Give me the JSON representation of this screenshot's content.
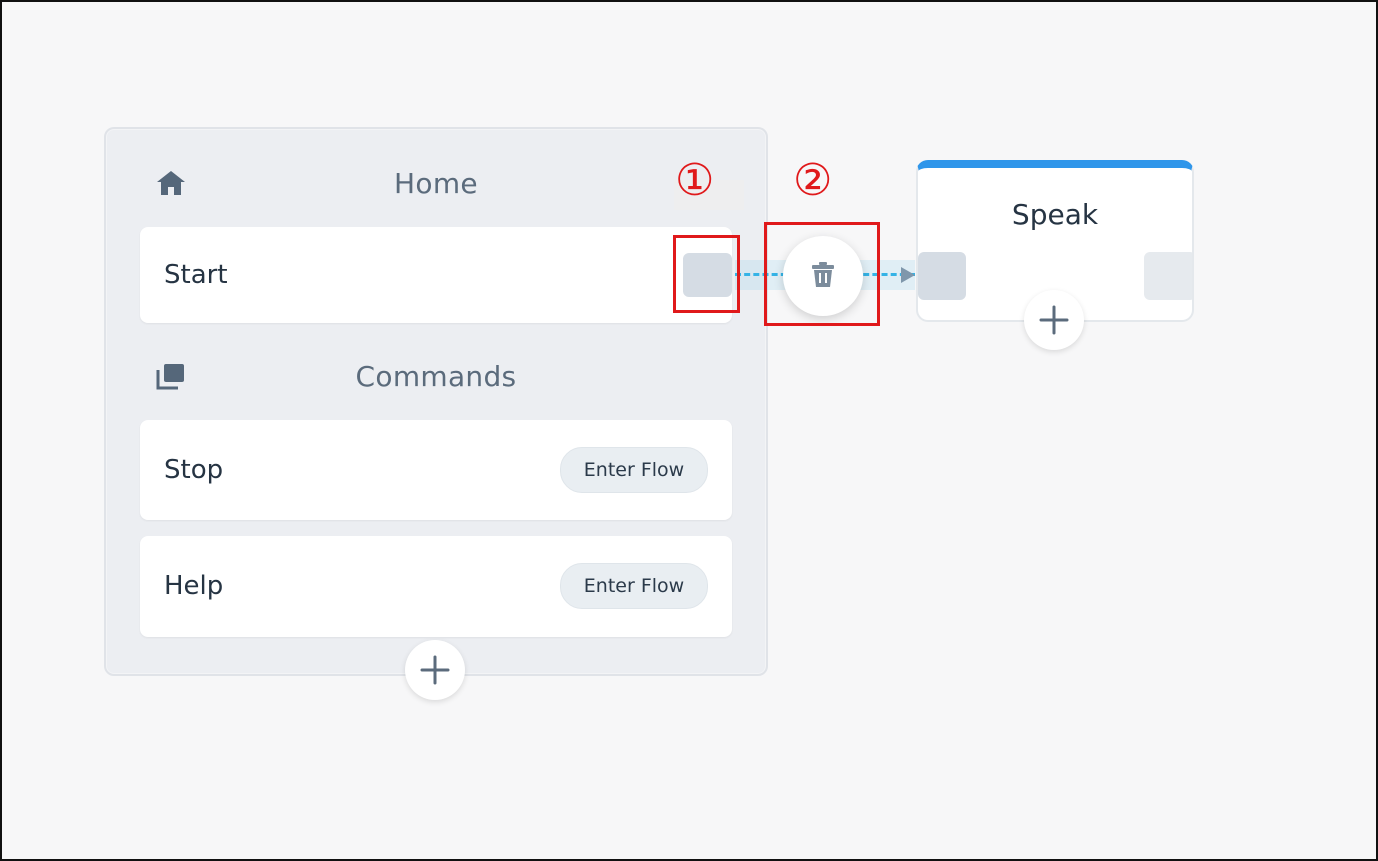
{
  "canvas": {
    "background": "#f7f7f8",
    "border_color": "#111111"
  },
  "home_panel": {
    "home_header": {
      "title": "Home",
      "icon": "home-icon"
    },
    "start_card": {
      "label": "Start"
    },
    "commands_header": {
      "title": "Commands",
      "icon": "stacked-cards-icon"
    },
    "commands": [
      {
        "label": "Stop",
        "button_label": "Enter Flow"
      },
      {
        "label": "Help",
        "button_label": "Enter Flow"
      }
    ],
    "add_icon": "plus-icon"
  },
  "connector": {
    "color": "#34b3e6",
    "delete_icon": "trash-icon"
  },
  "speak_node": {
    "title": "Speak",
    "accent_color": "#2f96ea",
    "add_icon": "plus-icon"
  },
  "annotations": {
    "color": "#e0191b",
    "callout_1": "①",
    "callout_2": "②"
  }
}
